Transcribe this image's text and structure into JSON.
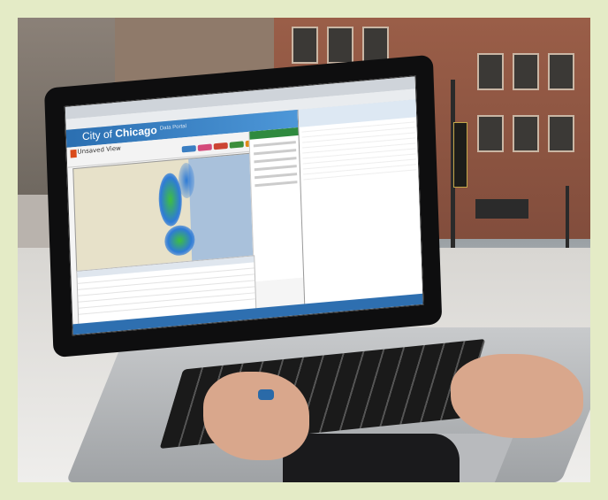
{
  "screen": {
    "brand": {
      "city_prefix": "City of",
      "city_name": "Chicago",
      "subtitle": "Data Portal"
    },
    "toolbar_text": "Unsaved View",
    "button_colors": [
      "#3a7ec2",
      "#d44a7a",
      "#c43",
      "#3b8e3b",
      "#e08a1a",
      "#d33"
    ],
    "panel_header_color": "#2f8a3f"
  },
  "colors": {
    "frame": "#e4ebc6",
    "brand_bar": "#2b6fb1",
    "heat": "#2e7bd6"
  }
}
